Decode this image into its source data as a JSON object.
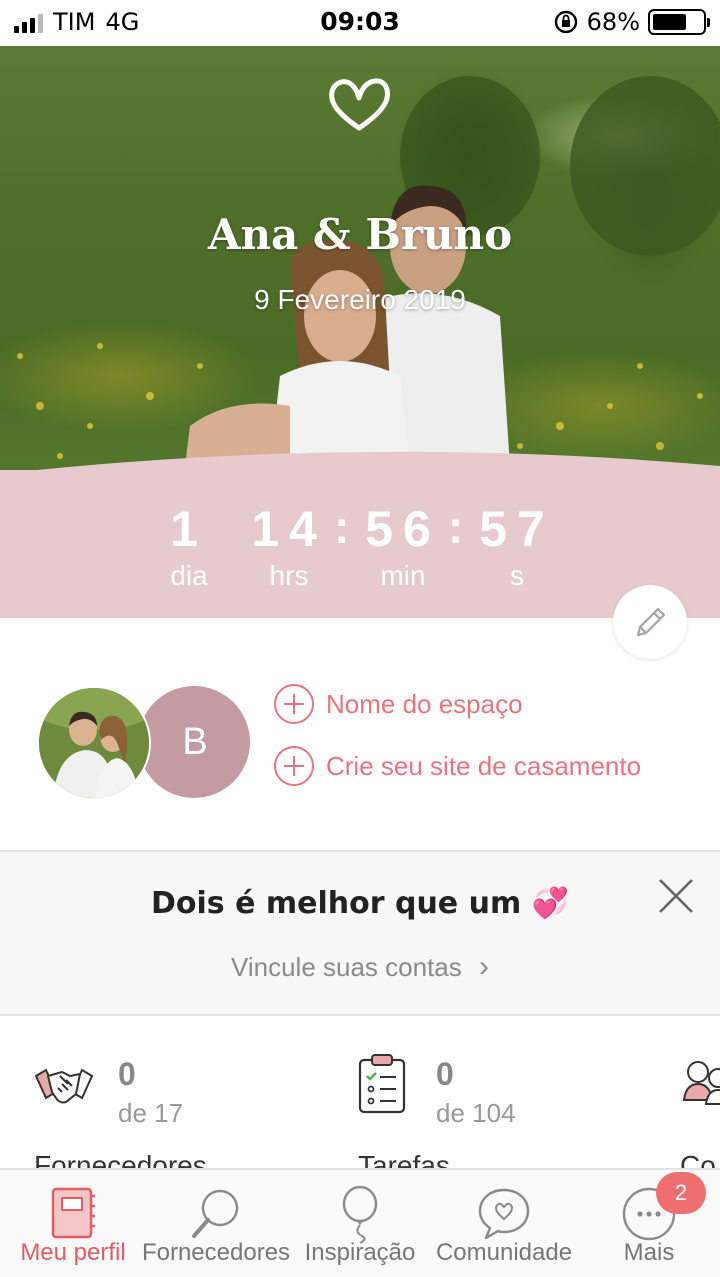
{
  "status_bar": {
    "carrier": "TIM",
    "network": "4G",
    "time": "09:03",
    "battery": "68%",
    "battery_level": 0.68
  },
  "hero": {
    "names": "Ana & Bruno",
    "date": "9 Fevereiro 2019",
    "heart_icon": "heart-outline-icon"
  },
  "countdown": {
    "days": {
      "value": "1",
      "label": "dia"
    },
    "hours": {
      "value": "14",
      "label": "hrs"
    },
    "minutes": {
      "value": "56",
      "label": "min"
    },
    "seconds": {
      "value": "57",
      "label": "s"
    },
    "separator": ":"
  },
  "profile": {
    "avatar_initial": "B",
    "links": [
      {
        "label": "Nome do espaço",
        "icon": "plus-circle-icon"
      },
      {
        "label": "Crie seu site de casamento",
        "icon": "plus-circle-icon"
      }
    ]
  },
  "banner": {
    "title": "Dois é melhor que um 💞",
    "subtitle": "Vincule suas contas",
    "chevron": "›"
  },
  "stats": [
    {
      "icon": "handshake-icon",
      "count": "0",
      "of": "de 17",
      "label": "Fornecedores"
    },
    {
      "icon": "checklist-icon",
      "count": "0",
      "of": "de 104",
      "label": "Tarefas"
    },
    {
      "icon": "guests-icon",
      "label": "Co"
    }
  ],
  "tabs": [
    {
      "label": "Meu perfil",
      "icon": "notebook-icon",
      "active": true
    },
    {
      "label": "Fornecedores",
      "icon": "magnifier-icon",
      "active": false
    },
    {
      "label": "Inspiração",
      "icon": "balloon-icon",
      "active": false
    },
    {
      "label": "Comunidade",
      "icon": "chat-heart-icon",
      "active": false
    },
    {
      "label": "Mais",
      "icon": "more-icon",
      "active": false,
      "badge": "2"
    }
  ],
  "colors": {
    "accent": "#e65a63",
    "countdown_bg": "#e7cacd",
    "avatar_bg": "#c49aa3"
  }
}
